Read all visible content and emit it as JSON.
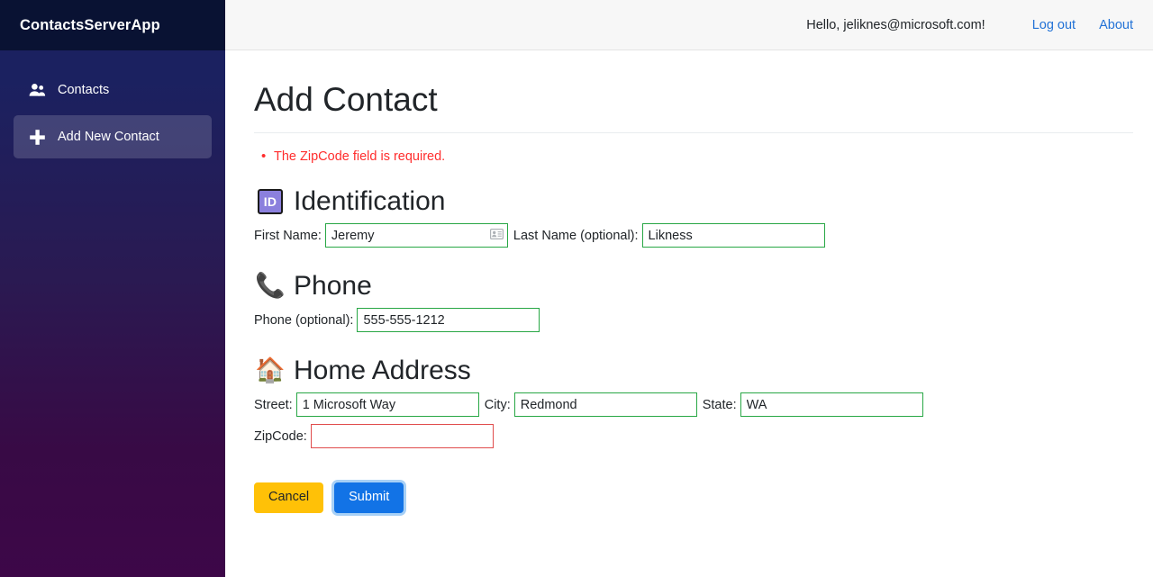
{
  "sidebar": {
    "brand": "ContactsServerApp",
    "items": [
      {
        "label": "Contacts",
        "icon": "people-icon",
        "active": false
      },
      {
        "label": "Add New Contact",
        "icon": "plus-icon",
        "active": true
      }
    ]
  },
  "topbar": {
    "greeting": "Hello, jeliknes@microsoft.com!",
    "logout_label": "Log out",
    "about_label": "About"
  },
  "page": {
    "title": "Add Contact",
    "validation_errors": [
      "The ZipCode field is required."
    ]
  },
  "sections": {
    "identification": {
      "title": "Identification",
      "icon": "id-badge-icon",
      "icon_text": "ID",
      "fields": {
        "first_name": {
          "label": "First Name:",
          "value": "Jeremy",
          "placeholder": "",
          "icon": "contact-card-icon"
        },
        "last_name": {
          "label": "Last Name (optional):",
          "value": "Likness",
          "placeholder": ""
        }
      }
    },
    "phone": {
      "title": "Phone",
      "icon": "telephone-receiver-icon",
      "icon_glyph": "📞",
      "fields": {
        "phone": {
          "label": "Phone (optional):",
          "value": "555-555-1212",
          "placeholder": ""
        }
      }
    },
    "home_address": {
      "title": "Home Address",
      "icon": "house-icon",
      "icon_glyph": "🏠",
      "fields": {
        "street": {
          "label": "Street:",
          "value": "1 Microsoft Way",
          "placeholder": ""
        },
        "city": {
          "label": "City:",
          "value": "Redmond",
          "placeholder": ""
        },
        "state": {
          "label": "State:",
          "value": "WA",
          "placeholder": ""
        },
        "zipcode": {
          "label": "ZipCode:",
          "value": "",
          "placeholder": "",
          "invalid": true
        }
      }
    }
  },
  "actions": {
    "cancel_label": "Cancel",
    "submit_label": "Submit"
  },
  "colors": {
    "sidebar_top": "#1b2160",
    "sidebar_bottom": "#3d0748",
    "brandbar": "#091233",
    "link": "#2272d6",
    "error": "#ff2d2d",
    "valid_border": "#28a745",
    "invalid_border": "#e04c4c",
    "cancel_bg": "#ffc107",
    "submit_bg": "#1273e6",
    "id_badge_bg": "#8b80dd"
  }
}
